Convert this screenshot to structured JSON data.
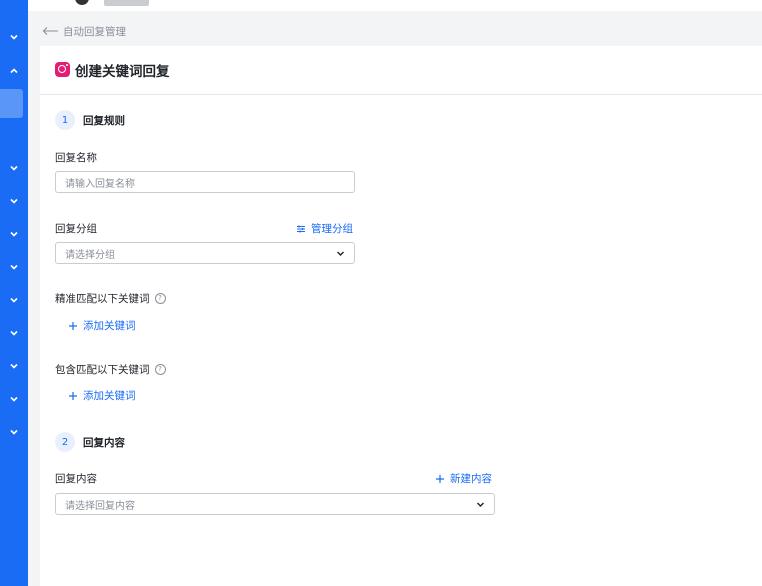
{
  "breadcrumb": {
    "label": "自动回复管理"
  },
  "header": {
    "title": "创建关键词回复"
  },
  "steps": [
    {
      "num": "1",
      "title": "回复规则"
    },
    {
      "num": "2",
      "title": "回复内容"
    }
  ],
  "form": {
    "reply_name_label": "回复名称",
    "reply_name_placeholder": "请输入回复名称",
    "reply_group_label": "回复分组",
    "manage_group_link": "管理分组",
    "reply_group_placeholder": "请选择分组",
    "exact_match_label": "精准匹配以下关键词",
    "exact_match_add": "添加关键词",
    "contains_match_label": "包含匹配以下关键词",
    "contains_match_add": "添加关键词",
    "reply_content_label": "回复内容",
    "new_content_link": "新建内容",
    "reply_content_placeholder": "请选择回复内容"
  },
  "colors": {
    "brand": "#1a6cf5",
    "instagram": "#e11d74"
  }
}
